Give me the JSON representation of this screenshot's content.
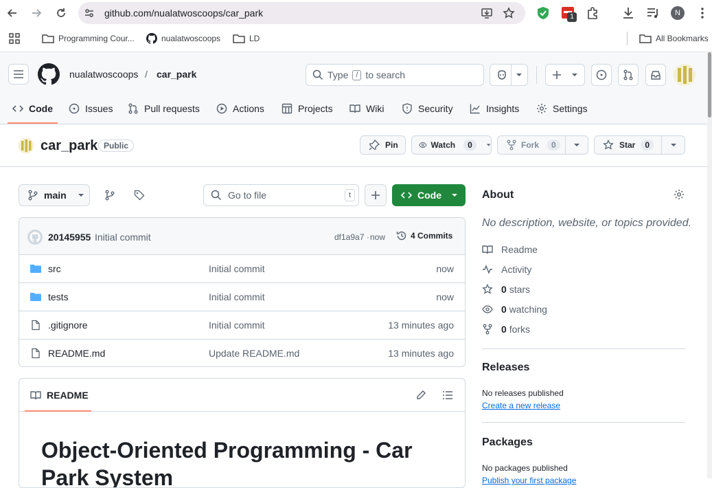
{
  "browser": {
    "url": "github.com/nualatwoscoops/car_park",
    "extension_badge": "1",
    "profile_initial": "N",
    "bookmarks": [
      {
        "label": "Programming Cour..."
      },
      {
        "label": "nualatwoscoops"
      },
      {
        "label": "LD"
      }
    ],
    "all_bookmarks": "All Bookmarks"
  },
  "header": {
    "owner": "nualatwoscoops",
    "separator": "/",
    "repo": "car_park",
    "search_prefix": "Type",
    "search_key": "/",
    "search_suffix": "to search"
  },
  "tabs": [
    {
      "label": "Code",
      "icon": "code-icon"
    },
    {
      "label": "Issues",
      "icon": "issue-icon"
    },
    {
      "label": "Pull requests",
      "icon": "pull-request-icon"
    },
    {
      "label": "Actions",
      "icon": "play-icon"
    },
    {
      "label": "Projects",
      "icon": "table-icon"
    },
    {
      "label": "Wiki",
      "icon": "book-icon"
    },
    {
      "label": "Security",
      "icon": "shield-icon"
    },
    {
      "label": "Insights",
      "icon": "graph-icon"
    },
    {
      "label": "Settings",
      "icon": "gear-icon"
    }
  ],
  "repo": {
    "name": "car_park",
    "visibility": "Public",
    "pin_label": "Pin",
    "watch_label": "Watch",
    "watch_count": "0",
    "fork_label": "Fork",
    "fork_count": "0",
    "star_label": "Star",
    "star_count": "0"
  },
  "toolbar": {
    "branch": "main",
    "goto_placeholder": "Go to file",
    "goto_key": "t",
    "code_label": "Code"
  },
  "commit": {
    "author": "20145955",
    "message": "Initial commit",
    "sha": "df1a9a7",
    "dot": "·",
    "time": "now",
    "commits_label": "4 Commits"
  },
  "files": [
    {
      "name": "src",
      "type": "folder",
      "message": "Initial commit",
      "age": "now"
    },
    {
      "name": "tests",
      "type": "folder",
      "message": "Initial commit",
      "age": "now"
    },
    {
      "name": ".gitignore",
      "type": "file",
      "message": "Initial commit",
      "age": "13 minutes ago"
    },
    {
      "name": "README.md",
      "type": "file",
      "message": "Update README.md",
      "age": "13 minutes ago"
    }
  ],
  "readme": {
    "tab_label": "README",
    "heading_line1": "Object-Oriented Programming - Car",
    "heading_line2": "Park System"
  },
  "about": {
    "title": "About",
    "description": "No description, website, or topics provided.",
    "readme_label": "Readme",
    "activity_label": "Activity",
    "stars_count": "0",
    "stars_label": "stars",
    "watching_count": "0",
    "watching_label": "watching",
    "forks_count": "0",
    "forks_label": "forks"
  },
  "releases": {
    "title": "Releases",
    "text": "No releases published",
    "link": "Create a new release"
  },
  "packages": {
    "title": "Packages",
    "text": "No packages published",
    "link": "Publish your first package"
  },
  "colors": {
    "accent_green": "#1f883d",
    "link_blue": "#0969da",
    "folder_blue": "#54aeff",
    "tab_underline": "#fd8c73"
  }
}
